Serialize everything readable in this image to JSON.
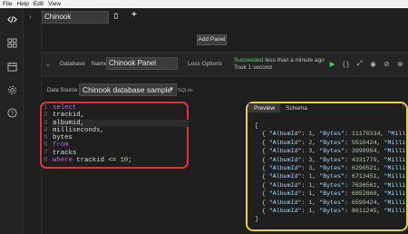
{
  "menu": [
    "File",
    "Help",
    "Edit",
    "View"
  ],
  "tab": {
    "name": "Chinook"
  },
  "add_panel_label": "Add Panel",
  "panel": {
    "type_label": "Database",
    "name_label": "Name",
    "name_value": "Chinook Panel",
    "options_label": "Loss Options",
    "status_ok": "Succeeded",
    "status_rest": " less than a minute ago",
    "status_time": "Took 1 second",
    "icons": [
      "play-icon",
      "braces-icon",
      "expand-icon",
      "eye-icon",
      "link-icon",
      "hide-icon",
      "trash-icon"
    ]
  },
  "datasource": {
    "label": "Data Source",
    "value": "Chinook database sample",
    "dialect": "SQLite"
  },
  "query_lines": [
    {
      "n": "1",
      "kind": "kw",
      "text": "select"
    },
    {
      "n": "2",
      "kind": "id",
      "text": "trackid,"
    },
    {
      "n": "3",
      "kind": "id",
      "text": "albumid,"
    },
    {
      "n": "4",
      "kind": "id",
      "text": "milliseconds,"
    },
    {
      "n": "5",
      "kind": "id",
      "text": "bytes"
    },
    {
      "n": "6",
      "kind": "kw",
      "text": "from"
    },
    {
      "n": "7",
      "kind": "id",
      "text": "tracks"
    },
    {
      "n": "8",
      "kind": "where",
      "text": "where trackid <= 10;"
    }
  ],
  "preview_tabs": [
    "Preview",
    "Schema"
  ],
  "results": [
    {
      "AlbumId": 1,
      "Bytes": "11170334"
    },
    {
      "AlbumId": 2,
      "Bytes": "5510424"
    },
    {
      "AlbumId": 3,
      "Bytes": "3990994"
    },
    {
      "AlbumId": 3,
      "Bytes": "4331779"
    },
    {
      "AlbumId": 3,
      "Bytes": "6290521"
    },
    {
      "AlbumId": 1,
      "Bytes": "6713451"
    },
    {
      "AlbumId": 1,
      "Bytes": "7636561"
    },
    {
      "AlbumId": 1,
      "Bytes": "6852860"
    },
    {
      "AlbumId": 1,
      "Bytes": "6599424"
    },
    {
      "AlbumId": 1,
      "Bytes": "8611245"
    }
  ],
  "result_tail_key": "Millis",
  "colors": {
    "success": "#5fd35f",
    "editor_highlight": "#e03434",
    "preview_highlight": "#e6d23a"
  }
}
